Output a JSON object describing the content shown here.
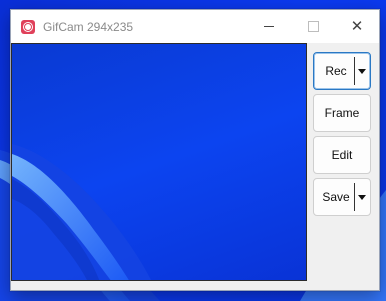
{
  "window": {
    "title": "GifCam 294x235"
  },
  "titlebar": {
    "app_icon": "camera-icon",
    "minimize_icon": "minimize-icon",
    "maximize_icon": "maximize-icon",
    "close_icon": "close-icon",
    "close_glyph": "✕"
  },
  "side_panel": {
    "rec_label": "Rec",
    "frame_label": "Frame",
    "edit_label": "Edit",
    "save_label": "Save",
    "dropdown_icon": "chevron-down-icon"
  },
  "colors": {
    "accent_border": "#2a78c4",
    "app_icon": "#e0405a",
    "wallpaper_blue": "#0b3af0"
  }
}
